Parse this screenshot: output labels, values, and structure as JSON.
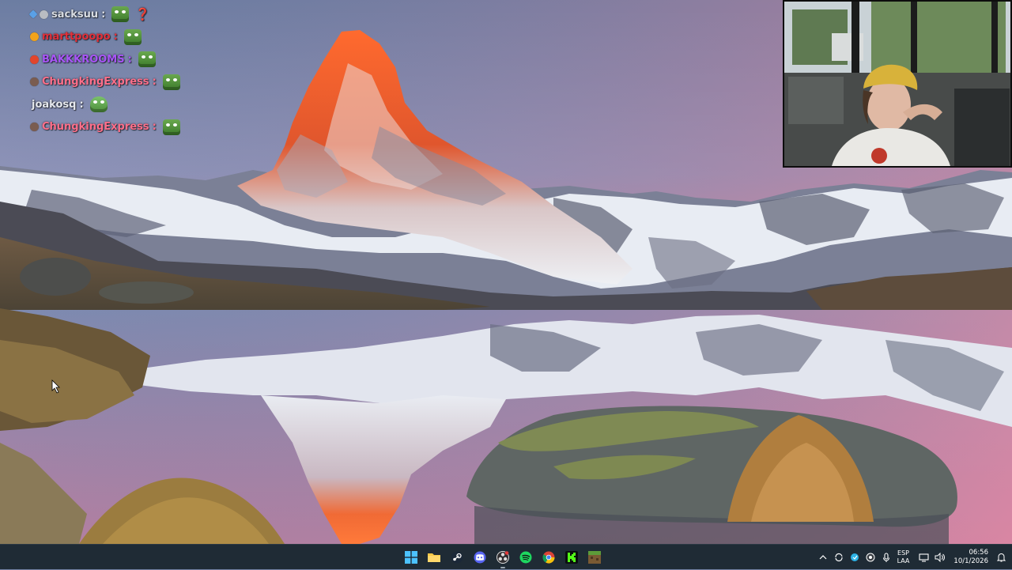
{
  "chat": {
    "messages": [
      {
        "user": "sacksuu",
        "color": "#d9dde3",
        "badge_color": "#5aa0e6",
        "emote": "green-emote",
        "extra": "❓"
      },
      {
        "user": "marttpoopo",
        "color": "#e2303a",
        "badge_color": "#f2a31b",
        "emote": "green-emote",
        "extra": ""
      },
      {
        "user": "BAKKKROOMS",
        "color": "#a855f7",
        "badge_color": "#e2452c",
        "emote": "green-emote",
        "extra": ""
      },
      {
        "user": "ChungkingExpress",
        "color": "#ff6f8a",
        "badge_color": "#7a5c50",
        "emote": "green-emote",
        "extra": ""
      },
      {
        "user": "joakosq",
        "color": "#e6e9ee",
        "badge_color": "",
        "emote": "pepe-emote",
        "extra": ""
      },
      {
        "user": "ChungkingExpress",
        "color": "#ff6f8a",
        "badge_color": "#7a5c50",
        "emote": "green-emote",
        "extra": ""
      }
    ]
  },
  "taskbar": {
    "apps": [
      {
        "name": "start-button",
        "icon": "windows-icon"
      },
      {
        "name": "file-explorer",
        "icon": "folder-icon"
      },
      {
        "name": "steam",
        "icon": "steam-icon"
      },
      {
        "name": "discord",
        "icon": "discord-icon"
      },
      {
        "name": "obs",
        "icon": "obs-icon"
      },
      {
        "name": "spotify",
        "icon": "spotify-icon"
      },
      {
        "name": "chrome",
        "icon": "chrome-icon"
      },
      {
        "name": "kick",
        "icon": "kick-icon"
      },
      {
        "name": "minecraft",
        "icon": "minecraft-icon"
      }
    ],
    "tray": {
      "language_top": "ESP",
      "language_bottom": "LAA",
      "time": "06:56",
      "date": "10/1/2026"
    }
  },
  "colors": {
    "taskbar_bg": "#1f2b35",
    "accent": "#4cc2ff"
  }
}
